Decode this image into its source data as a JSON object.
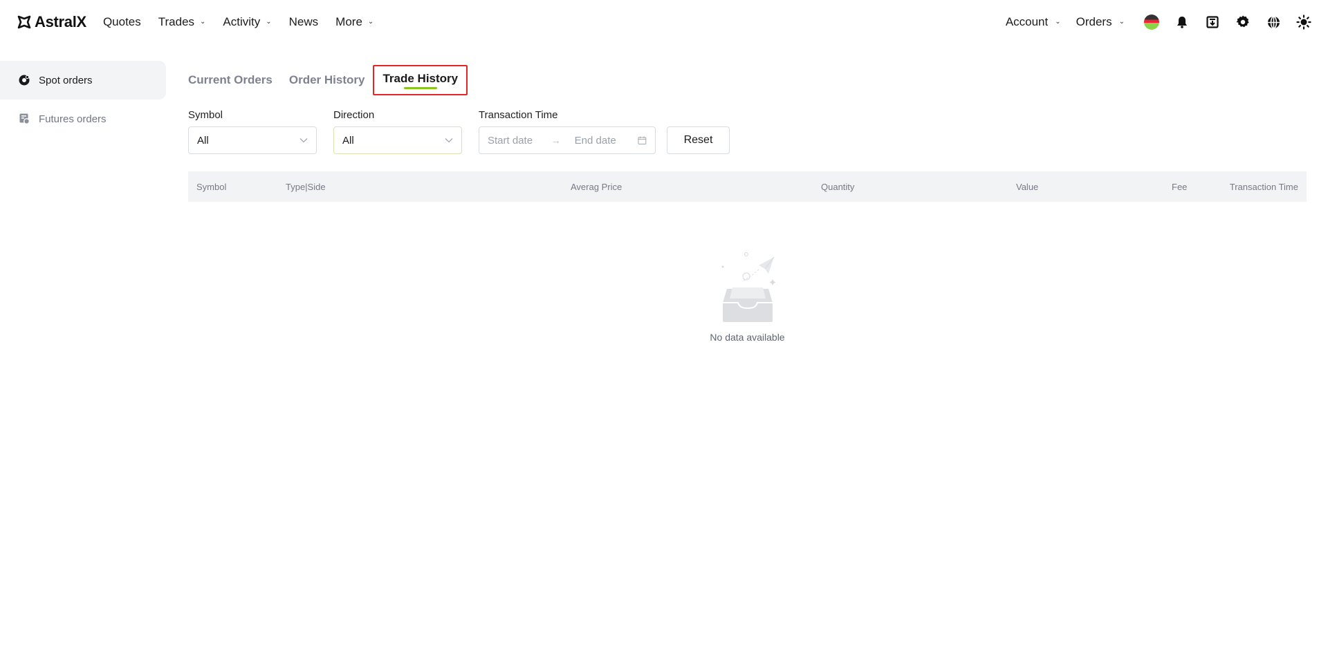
{
  "brand": {
    "name": "AstralX"
  },
  "nav": {
    "left": [
      {
        "label": "Quotes",
        "dropdown": false
      },
      {
        "label": "Trades",
        "dropdown": true
      },
      {
        "label": "Activity",
        "dropdown": true
      },
      {
        "label": "News",
        "dropdown": false
      },
      {
        "label": "More",
        "dropdown": true
      }
    ],
    "right": [
      {
        "label": "Account",
        "dropdown": true
      },
      {
        "label": "Orders",
        "dropdown": true
      }
    ],
    "icons": [
      "avatar",
      "bell-icon",
      "download-icon",
      "gear-icon",
      "globe-icon",
      "sun-icon"
    ]
  },
  "sidebar": {
    "items": [
      {
        "label": "Spot orders",
        "icon": "spot-icon",
        "active": true
      },
      {
        "label": "Futures orders",
        "icon": "futures-icon",
        "active": false
      }
    ]
  },
  "tabs": [
    {
      "label": "Current Orders",
      "active": false
    },
    {
      "label": "Order History",
      "active": false
    },
    {
      "label": "Trade History",
      "active": true
    }
  ],
  "filters": {
    "symbol": {
      "label": "Symbol",
      "value": "All"
    },
    "direction": {
      "label": "Direction",
      "value": "All"
    },
    "transaction_time": {
      "label": "Transaction Time",
      "start_placeholder": "Start date",
      "end_placeholder": "End date"
    },
    "reset_label": "Reset"
  },
  "table": {
    "columns": [
      "Symbol",
      "Type|Side",
      "Averag Price",
      "Quantity",
      "Value",
      "Fee",
      "Transaction Time"
    ],
    "empty_text": "No data available"
  },
  "colors": {
    "accent": "#8ac520",
    "highlight_border": "#e52626",
    "table_header_bg": "#f2f3f5",
    "sidebar_active_bg": "#f3f4f6"
  }
}
